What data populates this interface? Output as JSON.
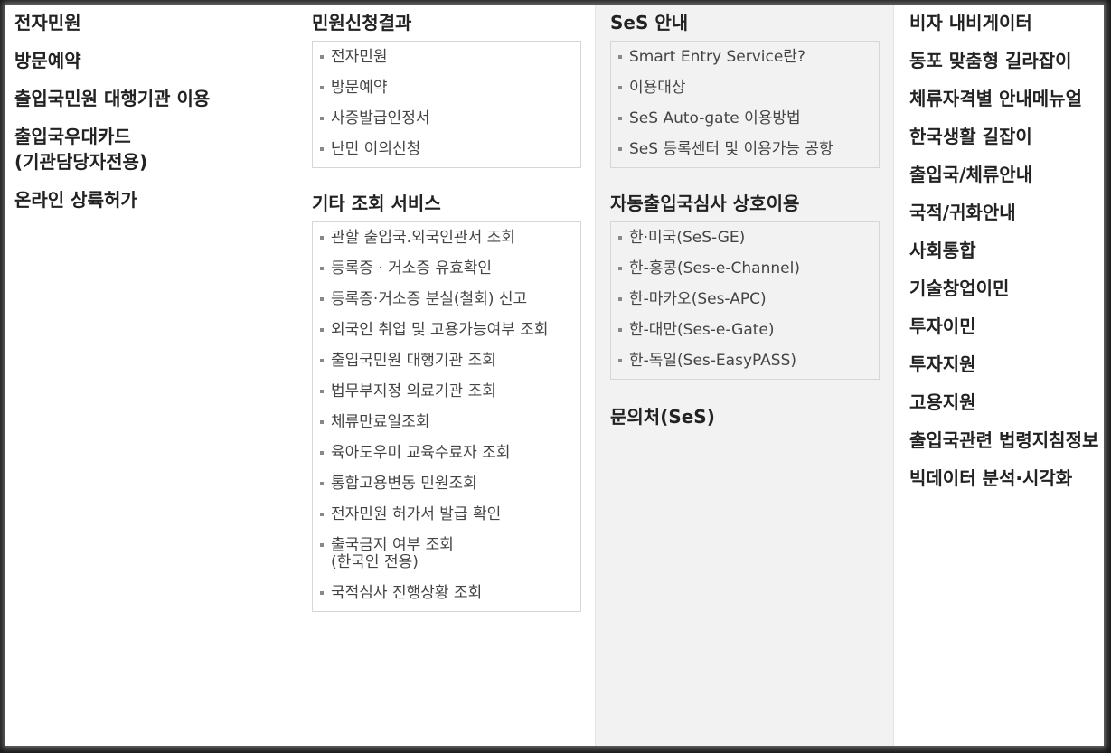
{
  "col1": {
    "items": [
      "전자민원",
      "방문예약",
      "출입국민원 대행기관 이용",
      "출입국우대카드\n(기관담당자전용)",
      "온라인 상륙허가"
    ]
  },
  "col2": {
    "sec1": {
      "title": "민원신청결과",
      "items": [
        "전자민원",
        "방문예약",
        "사증발급인정서",
        "난민 이의신청"
      ]
    },
    "sec2": {
      "title": "기타 조회 서비스",
      "items": [
        "관할 출입국.외국인관서 조회",
        "등록증 · 거소증 유효확인",
        "등록증·거소증 분실(철회) 신고",
        "외국인 취업 및 고용가능여부 조회",
        "출입국민원 대행기관 조회",
        "법무부지정 의료기관 조회",
        "체류만료일조회",
        "육아도우미 교육수료자 조회",
        "통합고용변동 민원조회",
        "전자민원 허가서 발급 확인",
        "출국금지 여부 조회\n(한국인 전용)",
        "국적심사 진행상황 조회"
      ]
    }
  },
  "col3": {
    "sec1": {
      "title": "SeS 안내",
      "items": [
        "Smart Entry Service란?",
        "이용대상",
        "SeS Auto-gate 이용방법",
        "SeS 등록센터 및 이용가능 공항"
      ]
    },
    "sec2": {
      "title": "자동출입국심사 상호이용",
      "items": [
        "한·미국(SeS-GE)",
        "한-홍콩(Ses-e-Channel)",
        "한-마카오(Ses-APC)",
        "한-대만(Ses-e-Gate)",
        "한-독일(Ses-EasyPASS)"
      ]
    },
    "sec3": {
      "title": "문의처(SeS)"
    }
  },
  "col4": {
    "items": [
      "비자 내비게이터",
      "동포 맞춤형 길라잡이",
      "체류자격별 안내메뉴얼",
      "한국생활 길잡이",
      "출입국/체류안내",
      "국적/귀화안내",
      "사회통합",
      "기술창업이민",
      "투자이민",
      "투자지원",
      "고용지원",
      "출입국관련 법령지침정보",
      "빅데이터 분석·시각화"
    ]
  }
}
